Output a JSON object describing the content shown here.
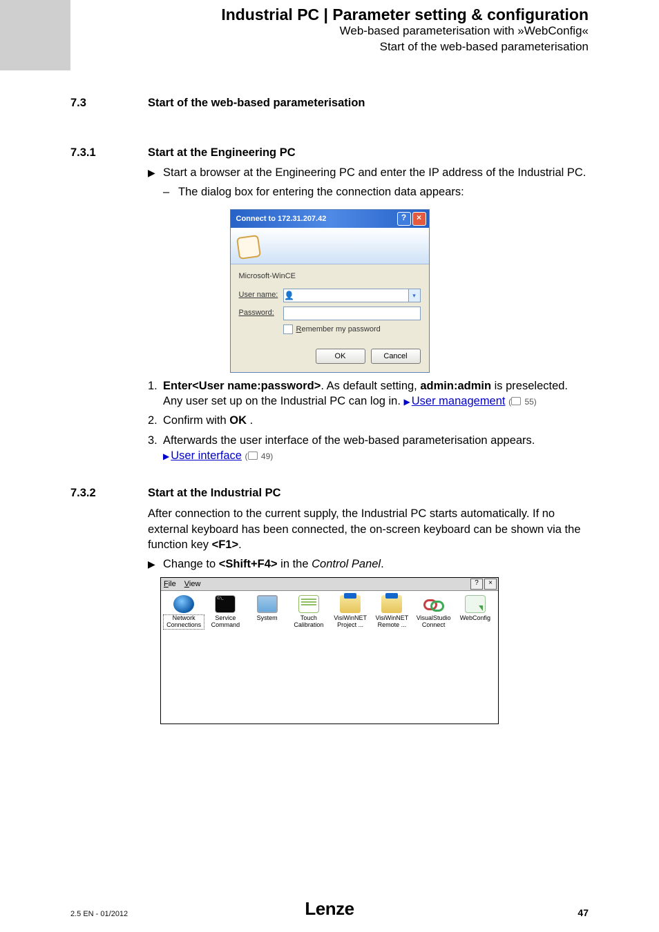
{
  "header": {
    "title": "Industrial PC | Parameter setting & configuration",
    "sub1": "Web-based parameterisation with »WebConfig«",
    "sub2": "Start of the web-based parameterisation"
  },
  "sec73": {
    "num": "7.3",
    "title": "Start of the web-based parameterisation"
  },
  "sec731": {
    "num": "7.3.1",
    "title": "Start at the Engineering PC",
    "bullet": "Start a browser at the Engineering PC and enter the IP address of the Industrial PC.",
    "subdash": "The dialog box for entering the connection data appears:",
    "step1_pre": "Enter<User name:password>",
    "step1_mid1": ". As default setting, ",
    "step1_bold": "admin:admin",
    "step1_mid2": " is preselected. Any user set up on the Industrial PC can log in.  ",
    "step1_link": "User management",
    "step1_page": "55)",
    "step2_a": "Confirm with ",
    "step2_b": "OK",
    "step2_c": " .",
    "step3": "Afterwards the user interface of the web-based parameterisation appears.",
    "step3_link": "User interface",
    "step3_page": "49)"
  },
  "dialog": {
    "title": "Connect to 172.31.207.42",
    "realm": "Microsoft-WinCE",
    "user_label": "User name:",
    "pass_label": "Password:",
    "user_value": "",
    "pass_value": "",
    "remember": "Remember my password",
    "ok": "OK",
    "cancel": "Cancel"
  },
  "sec732": {
    "num": "7.3.2",
    "title": "Start at the Industrial PC",
    "p1a": "After connection to the current supply, the Industrial PC starts automatically. If no external keyboard has been connected, the on-screen keyboard can be shown via the function key ",
    "p1b": "<F1>",
    "p1c": ".",
    "bullet_a": "Change to ",
    "bullet_b": "<Shift+F4>",
    "bullet_c": " in the ",
    "bullet_d": "Control Panel",
    "bullet_e": "."
  },
  "cp": {
    "menu_file": "File",
    "menu_view": "View",
    "items": [
      {
        "label": "Network Connections"
      },
      {
        "label": "Service Command"
      },
      {
        "label": "System"
      },
      {
        "label": "Touch Calibration"
      },
      {
        "label": "VisiWinNET Project ..."
      },
      {
        "label": "VisiWinNET Remote ..."
      },
      {
        "label": "VisualStudio Connect"
      },
      {
        "label": "WebConfig"
      }
    ]
  },
  "steps": {
    "n1": "1.",
    "n2": "2.",
    "n3": "3."
  },
  "footer": {
    "left": "2.5 EN - 01/2012",
    "logo": "Lenze",
    "page": "47"
  }
}
